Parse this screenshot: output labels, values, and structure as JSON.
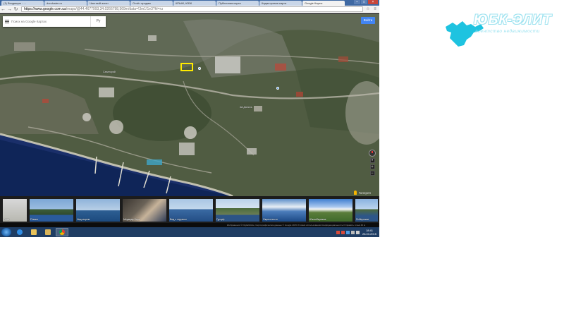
{
  "browser": {
    "tabs": [
      {
        "label": "(1) Входящие - ...",
        "active": false
      },
      {
        "label": "dorcluster.ru",
        "active": false
      },
      {
        "label": "Частный агент",
        "active": false
      },
      {
        "label": "Отчёт продаж",
        "active": false
      },
      {
        "label": "КРЫМ, ЮБК",
        "active": false
      },
      {
        "label": "Публичная карта",
        "active": false
      },
      {
        "label": "Кадастровая карта",
        "active": false
      },
      {
        "label": "Google Карты",
        "active": true
      }
    ],
    "url_host": "https://www.google.com.ua",
    "url_path": "/maps/@44.4677993,34.0266798,569m/data=!3m1!1e3?hl=ru"
  },
  "map": {
    "search_placeholder": "Поиск на Google Картах",
    "layers_label": "Ру",
    "signin_label": "Войти",
    "poi_labels": [
      "Санаторий",
      "Ай-Даниль"
    ],
    "photos_label": "Галерея"
  },
  "photos": [
    {
      "caption": "Ялта"
    },
    {
      "caption": "Пляжи"
    },
    {
      "caption": "Над морем"
    },
    {
      "caption": "Медведь-Гора"
    },
    {
      "caption": "Вид с террасы"
    },
    {
      "caption": "Гурзуф"
    },
    {
      "caption": "Окрестности"
    },
    {
      "caption": "Южнобережье"
    },
    {
      "caption": "Побережье"
    }
  ],
  "footer_text": "Изображения © DigitalGlobe, Картографические данные © Google 2015  Условия использования  Конфиденциальность  Отправить отзыв  40 м",
  "taskbar": {
    "time": "18:41",
    "date": "28.03.2015"
  },
  "logo": {
    "title": "ЮБК-ЭЛИТ",
    "subtitle": "агентство недвижимости",
    "colors": {
      "brand": "#1ec3e0",
      "accent": "#9fe3f0"
    }
  }
}
